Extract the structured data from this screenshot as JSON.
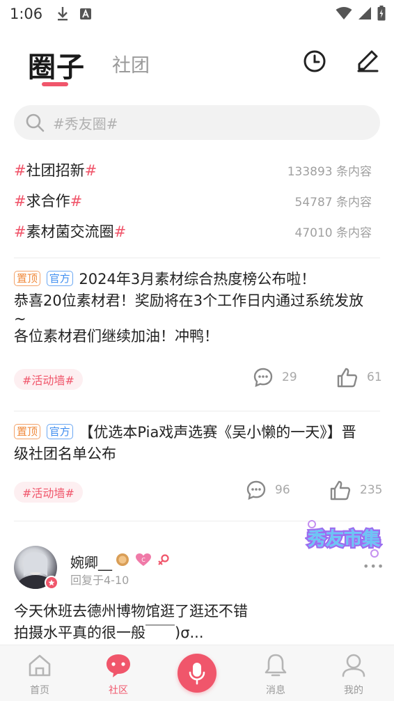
{
  "status_bar": {
    "time": "1:06"
  },
  "header": {
    "active_tab": "圈子",
    "inactive_tab": "社团"
  },
  "search": {
    "placeholder": "#秀友圈#"
  },
  "topics": [
    {
      "name": "社团招新",
      "count": "133893 条内容"
    },
    {
      "name": "求合作",
      "count": "54787 条内容"
    },
    {
      "name": "素材菌交流圈",
      "count": "47010 条内容"
    }
  ],
  "posts": [
    {
      "badge_top": "置顶",
      "badge_official": "官方",
      "title": "2024年3月素材综合热度榜公布啦！",
      "body_line1": "恭喜20位素材君！奖励将在3个工作日内通过系统发放",
      "body_line2": "~",
      "body_line3": "各位素材君们继续加油！冲鸭！",
      "tag": "#活动墙#",
      "comments": "29",
      "likes": "61"
    },
    {
      "badge_top": "置顶",
      "badge_official": "官方",
      "title_line1": "【优选本Pia戏声选赛《吴小懒的一天》】晋",
      "title_line2": "级社团名单公布",
      "tag": "#活动墙#",
      "comments": "96",
      "likes": "235"
    }
  ],
  "reply": {
    "user_name": "婉卿__",
    "time": "回复于4-10",
    "text_line1": "今天休班去德州博物馆逛了逛还不错",
    "text_line2": "拍摄水平真的很一般￣￣)σ...",
    "more": "•••"
  },
  "market_logo": "秀友市集",
  "bottom_nav": {
    "home": "首页",
    "community": "社区",
    "messages": "消息",
    "mine": "我的"
  },
  "colors": {
    "accent": "#f0566b",
    "top_badge": "#f08a3c",
    "official_badge": "#3f8ef0"
  }
}
